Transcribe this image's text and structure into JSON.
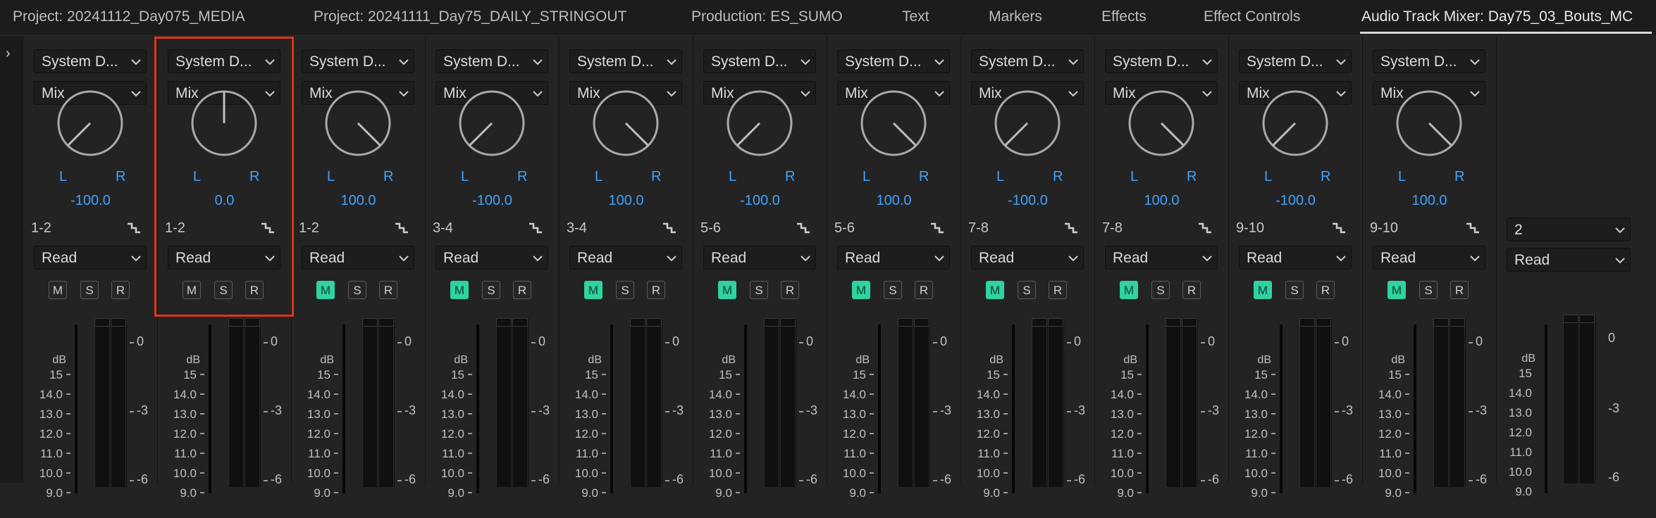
{
  "tabs": [
    {
      "label": "Project: 20241112_Day075_MEDIA"
    },
    {
      "label": "Project: 20241111_Day75_DAILY_STRINGOUT"
    },
    {
      "label": "Production: ES_SUMO"
    },
    {
      "label": "Text"
    },
    {
      "label": "Markers"
    },
    {
      "label": "Effects"
    },
    {
      "label": "Effect Controls"
    },
    {
      "label": "Audio Track Mixer: Day75_03_Bouts_MC"
    }
  ],
  "active_tab": 7,
  "expand_icon": "chevron-right-icon",
  "colors": {
    "accent": "#3fa3ff",
    "mute_on": "#2fd3a1",
    "highlight": "#e2341f"
  },
  "tracks": [
    {
      "input": "System D...",
      "mode": "Mix",
      "pan_value": "-100.0",
      "pan": -100,
      "pan_left": "L",
      "pan_right": "R",
      "routing": "1-2",
      "automation": "Read",
      "mute": "M",
      "solo": "S",
      "record": "R",
      "mute_on": false
    },
    {
      "input": "System D...",
      "mode": "Mix",
      "pan_value": "0.0",
      "pan": 0,
      "pan_left": "L",
      "pan_right": "R",
      "routing": "1-2",
      "automation": "Read",
      "mute": "M",
      "solo": "S",
      "record": "R",
      "mute_on": false
    },
    {
      "input": "System D...",
      "mode": "Mix",
      "pan_value": "100.0",
      "pan": 100,
      "pan_left": "L",
      "pan_right": "R",
      "routing": "1-2",
      "automation": "Read",
      "mute": "M",
      "solo": "S",
      "record": "R",
      "mute_on": true
    },
    {
      "input": "System D...",
      "mode": "Mix",
      "pan_value": "-100.0",
      "pan": -100,
      "pan_left": "L",
      "pan_right": "R",
      "routing": "3-4",
      "automation": "Read",
      "mute": "M",
      "solo": "S",
      "record": "R",
      "mute_on": true
    },
    {
      "input": "System D...",
      "mode": "Mix",
      "pan_value": "100.0",
      "pan": 100,
      "pan_left": "L",
      "pan_right": "R",
      "routing": "3-4",
      "automation": "Read",
      "mute": "M",
      "solo": "S",
      "record": "R",
      "mute_on": true
    },
    {
      "input": "System D...",
      "mode": "Mix",
      "pan_value": "-100.0",
      "pan": -100,
      "pan_left": "L",
      "pan_right": "R",
      "routing": "5-6",
      "automation": "Read",
      "mute": "M",
      "solo": "S",
      "record": "R",
      "mute_on": true
    },
    {
      "input": "System D...",
      "mode": "Mix",
      "pan_value": "100.0",
      "pan": 100,
      "pan_left": "L",
      "pan_right": "R",
      "routing": "5-6",
      "automation": "Read",
      "mute": "M",
      "solo": "S",
      "record": "R",
      "mute_on": true
    },
    {
      "input": "System D...",
      "mode": "Mix",
      "pan_value": "-100.0",
      "pan": -100,
      "pan_left": "L",
      "pan_right": "R",
      "routing": "7-8",
      "automation": "Read",
      "mute": "M",
      "solo": "S",
      "record": "R",
      "mute_on": true
    },
    {
      "input": "System D...",
      "mode": "Mix",
      "pan_value": "100.0",
      "pan": 100,
      "pan_left": "L",
      "pan_right": "R",
      "routing": "7-8",
      "automation": "Read",
      "mute": "M",
      "solo": "S",
      "record": "R",
      "mute_on": true
    },
    {
      "input": "System D...",
      "mode": "Mix",
      "pan_value": "-100.0",
      "pan": -100,
      "pan_left": "L",
      "pan_right": "R",
      "routing": "9-10",
      "automation": "Read",
      "mute": "M",
      "solo": "S",
      "record": "R",
      "mute_on": true
    },
    {
      "input": "System D...",
      "mode": "Mix",
      "pan_value": "100.0",
      "pan": 100,
      "pan_left": "L",
      "pan_right": "R",
      "routing": "9-10",
      "automation": "Read",
      "mute": "M",
      "solo": "S",
      "record": "R",
      "mute_on": true
    }
  ],
  "master": {
    "channel": "2",
    "automation": "Read"
  },
  "fader_scale": {
    "unit": "dB",
    "labels": [
      "15",
      "14.0",
      "13.0",
      "12.0",
      "11.0",
      "10.0",
      "9.0"
    ]
  },
  "meter_scale": {
    "labels": [
      "0",
      "-3",
      "-6"
    ]
  },
  "highlighted_track": 1
}
